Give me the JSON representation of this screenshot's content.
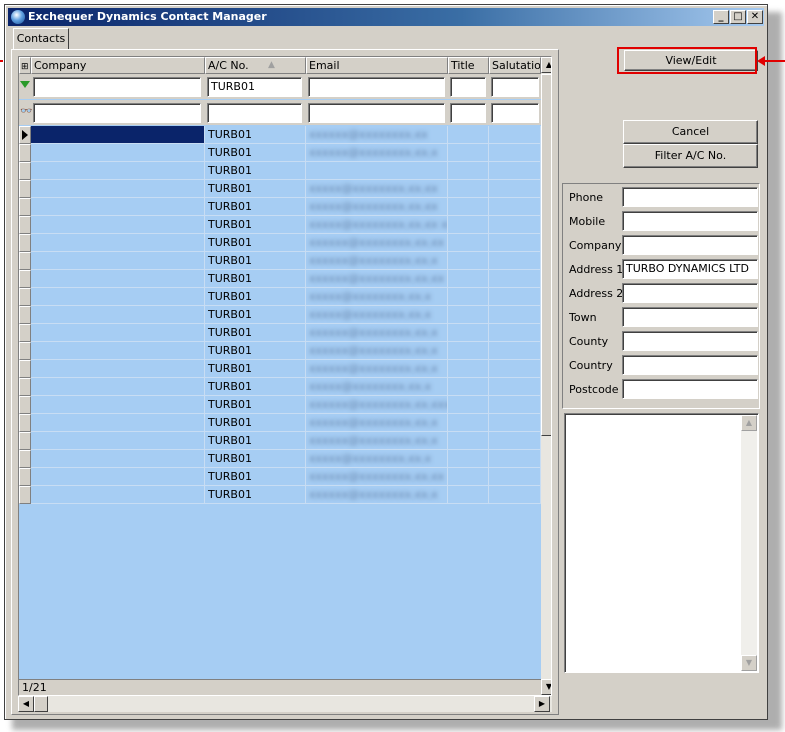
{
  "window": {
    "title": "Exchequer Dynamics Contact Manager",
    "min": "_",
    "max": "□",
    "close": "✕"
  },
  "tabs": [
    {
      "label": "Contacts"
    }
  ],
  "grid": {
    "columns": [
      {
        "label": "Company"
      },
      {
        "label": "A/C No."
      },
      {
        "label": "Email"
      },
      {
        "label": "Title"
      },
      {
        "label": "Salutation"
      }
    ],
    "filter_row": {
      "company": "",
      "ac_no": "TURB01",
      "email": "",
      "title": "",
      "salutation": ""
    },
    "search_row": {
      "company": "",
      "ac_no": "",
      "email": "",
      "title": "",
      "salutation": ""
    },
    "rows": [
      {
        "company": "",
        "ac_no": "TURB01",
        "email": "xxxxxx@xxxxxxxx.xx"
      },
      {
        "company": "",
        "ac_no": "TURB01",
        "email": "xxxxxx@xxxxxxxx.xx.x"
      },
      {
        "company": "",
        "ac_no": "TURB01",
        "email": ""
      },
      {
        "company": "",
        "ac_no": "TURB01",
        "email": "xxxxx@xxxxxxxx.xx.xx"
      },
      {
        "company": "",
        "ac_no": "TURB01",
        "email": "xxxxx@xxxxxxxx.xx.xx"
      },
      {
        "company": "",
        "ac_no": "TURB01",
        "email": "xxxxx@xxxxxxxx.xx.xx  xxxx"
      },
      {
        "company": "",
        "ac_no": "TURB01",
        "email": "xxxxxx@xxxxxxxx.xx.xx"
      },
      {
        "company": "",
        "ac_no": "TURB01",
        "email": "xxxxxx@xxxxxxxx.xx.x"
      },
      {
        "company": "",
        "ac_no": "TURB01",
        "email": "xxxxxx@xxxxxxxx.xx.xx"
      },
      {
        "company": "",
        "ac_no": "TURB01",
        "email": "xxxxx@xxxxxxxx.xx.x"
      },
      {
        "company": "",
        "ac_no": "TURB01",
        "email": "xxxxx@xxxxxxxx.xx.x"
      },
      {
        "company": "",
        "ac_no": "TURB01",
        "email": "xxxxxx@xxxxxxxx.xx.x"
      },
      {
        "company": "",
        "ac_no": "TURB01",
        "email": "xxxxxx@xxxxxxxx.xx.x"
      },
      {
        "company": "",
        "ac_no": "TURB01",
        "email": "xxxxxx@xxxxxxxx.xx.x"
      },
      {
        "company": "",
        "ac_no": "TURB01",
        "email": "xxxxx@xxxxxxxx.xx.x"
      },
      {
        "company": "",
        "ac_no": "TURB01",
        "email": "xxxxxx@xxxxxxxx.xx.xxxxx"
      },
      {
        "company": "",
        "ac_no": "TURB01",
        "email": "xxxxxx@xxxxxxxx.xx.x"
      },
      {
        "company": "",
        "ac_no": "TURB01",
        "email": "xxxxxx@xxxxxxxx.xx.x"
      },
      {
        "company": "",
        "ac_no": "TURB01",
        "email": "xxxxx@xxxxxxxx.xx.x"
      },
      {
        "company": "",
        "ac_no": "TURB01",
        "email": "xxxxxx@xxxxxxxx.xx.xx"
      },
      {
        "company": "",
        "ac_no": "TURB01",
        "email": "xxxxxx@xxxxxxxx.xx.x"
      }
    ],
    "status": "1/21"
  },
  "buttons": {
    "view_edit": "View/Edit",
    "cancel": "Cancel",
    "filter_ac": "Filter A/C No."
  },
  "details": {
    "phone": {
      "label": "Phone",
      "value": ""
    },
    "mobile": {
      "label": "Mobile",
      "value": ""
    },
    "company": {
      "label": "Company",
      "value": ""
    },
    "address1": {
      "label": "Address 1",
      "value": "TURBO DYNAMICS LTD"
    },
    "address2": {
      "label": "Address 2",
      "value": ""
    },
    "town": {
      "label": "Town",
      "value": ""
    },
    "county": {
      "label": "County",
      "value": ""
    },
    "country": {
      "label": "Country",
      "value": ""
    },
    "postcode": {
      "label": "Postcode",
      "value": ""
    }
  },
  "colors": {
    "highlight": "#e00000",
    "grid_bg": "#a6cdf3",
    "selected": "#0a246a"
  }
}
